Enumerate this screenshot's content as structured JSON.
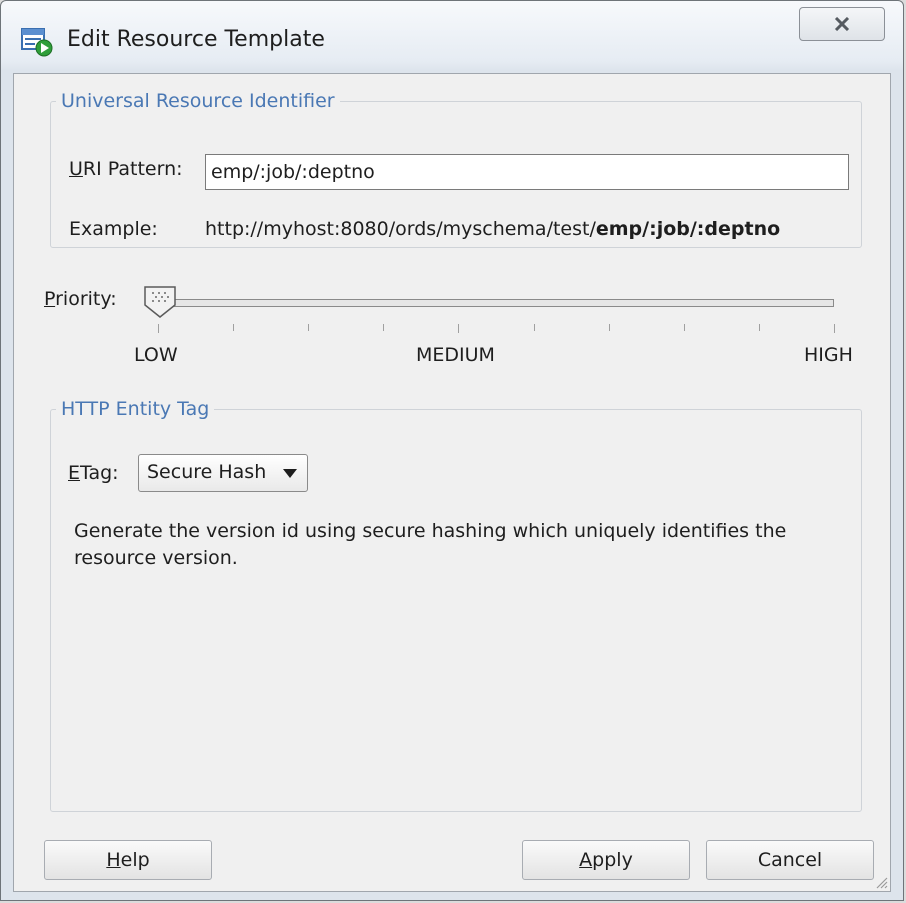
{
  "window": {
    "title": "Edit Resource Template"
  },
  "uri_group": {
    "legend": "Universal Resource Identifier",
    "uri_label_mnemonic": "U",
    "uri_label_rest": "RI Pattern:",
    "uri_value": "emp/:job/:deptno",
    "example_label": "Example:",
    "example_prefix": "http://myhost:8080/ords/myschema/test/",
    "example_suffix": "emp/:job/:deptno"
  },
  "priority": {
    "label_mnemonic": "P",
    "label_rest": "riority:",
    "value": 0,
    "min": 0,
    "max": 9,
    "ticks": [
      0,
      1,
      2,
      3,
      4,
      5,
      6,
      7,
      8,
      9
    ],
    "labels": [
      "LOW",
      "MEDIUM",
      "HIGH"
    ]
  },
  "etag_group": {
    "legend": "HTTP Entity Tag",
    "etag_label_mnemonic": "E",
    "etag_label_rest": "Tag:",
    "selected": "Secure Hash",
    "description": "Generate the version id using secure hashing which uniquely identifies the resource version."
  },
  "buttons": {
    "help_mnemonic": "H",
    "help_rest": "elp",
    "apply_mnemonic": "A",
    "apply_rest": "pply",
    "cancel": "Cancel"
  },
  "icons": {
    "app": "resource-template-icon",
    "close": "close-icon",
    "dropdown": "chevron-down-icon",
    "thumb": "slider-thumb-icon",
    "grip": "resize-grip-icon"
  }
}
